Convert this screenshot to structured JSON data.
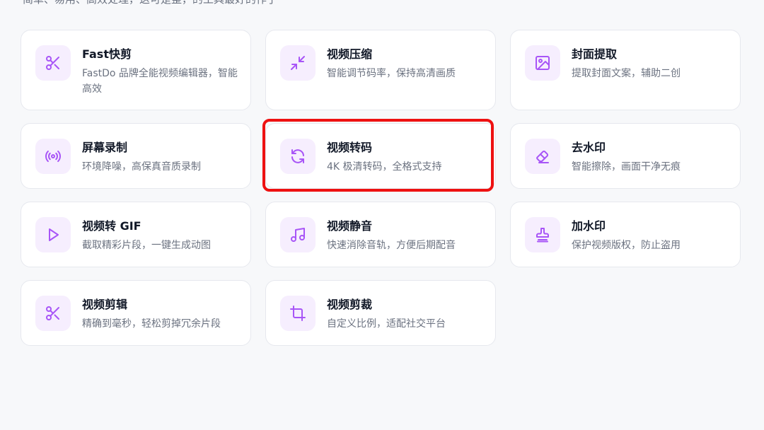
{
  "header": {
    "subtitle_partial": "简单、易用、高效处理，这可是整，的工具最好的作了"
  },
  "tools": [
    {
      "title": "Fast快剪",
      "desc": "FastDo 品牌全能视频编辑器，智能高效",
      "icon": "scissors-icon"
    },
    {
      "title": "视频压缩",
      "desc": "智能调节码率，保持高清画质",
      "icon": "compress-icon"
    },
    {
      "title": "封面提取",
      "desc": "提取封面文案，辅助二创",
      "icon": "image-icon"
    },
    {
      "title": "屏幕录制",
      "desc": "环境降噪，高保真音质录制",
      "icon": "broadcast-icon"
    },
    {
      "title": "视频转码",
      "desc": "4K 极清转码，全格式支持",
      "icon": "refresh-icon"
    },
    {
      "title": "去水印",
      "desc": "智能擦除，画面干净无痕",
      "icon": "eraser-icon"
    },
    {
      "title": "视频转 GIF",
      "desc": "截取精彩片段，一键生成动图",
      "icon": "play-icon"
    },
    {
      "title": "视频静音",
      "desc": "快速消除音轨，方便后期配音",
      "icon": "music-icon"
    },
    {
      "title": "加水印",
      "desc": "保护视频版权，防止盗用",
      "icon": "stamp-icon"
    },
    {
      "title": "视频剪辑",
      "desc": "精确到毫秒，轻松剪掉冗余片段",
      "icon": "scissors-icon"
    },
    {
      "title": "视频剪裁",
      "desc": "自定义比例，适配社交平台",
      "icon": "crop-icon"
    }
  ],
  "colors": {
    "accent": "#a855f7",
    "icon_bg": "#f6eefe",
    "highlight": "#ee1111"
  }
}
